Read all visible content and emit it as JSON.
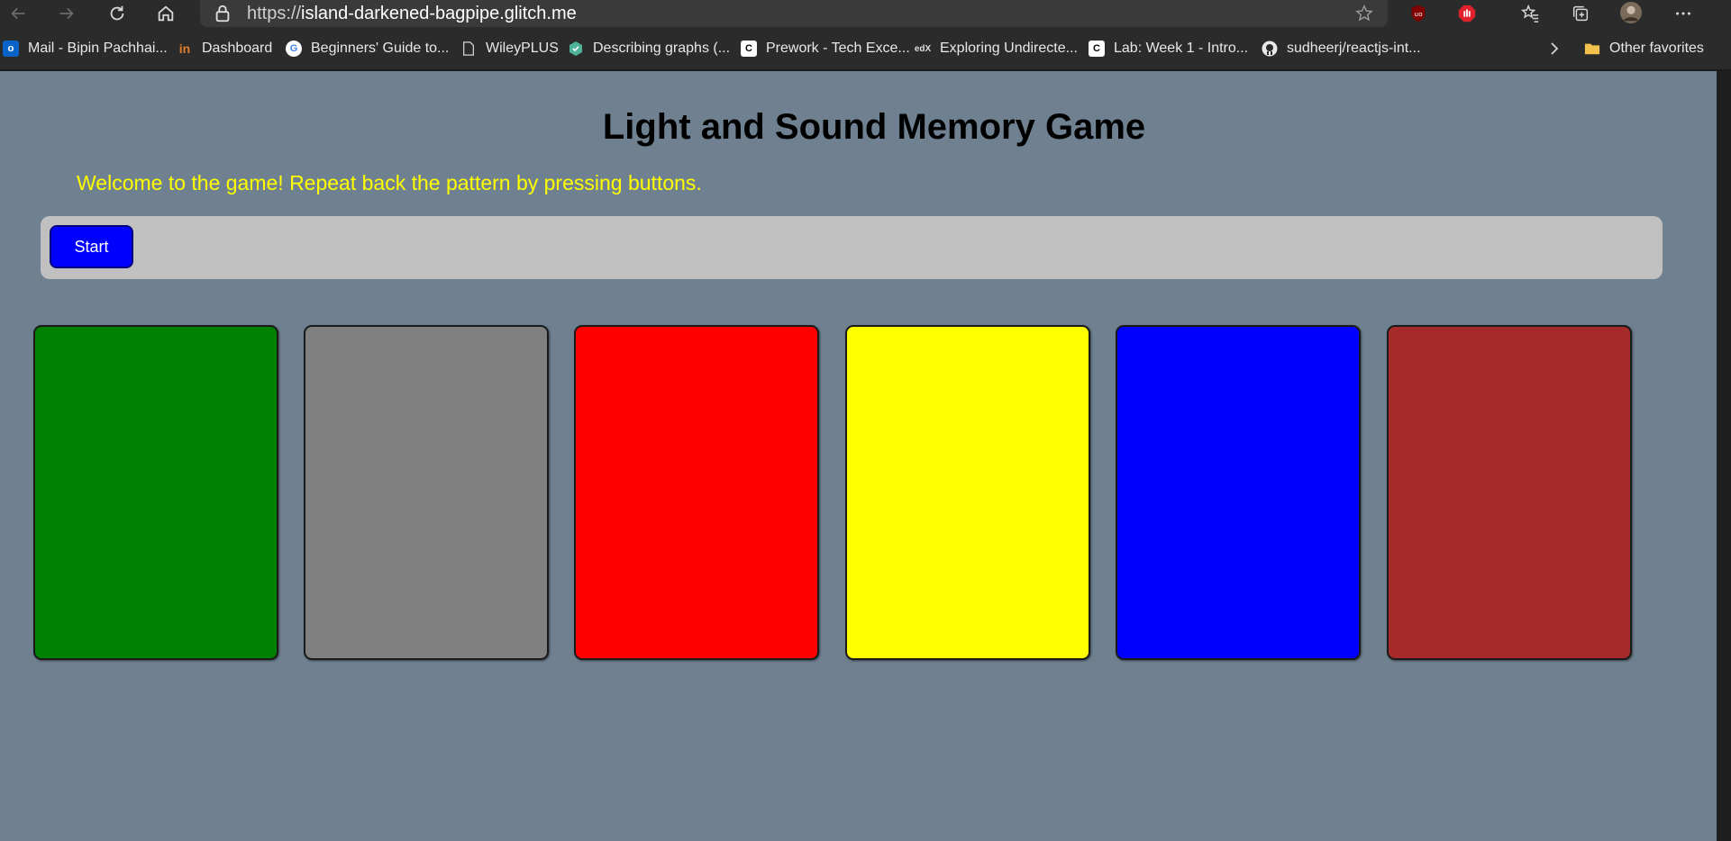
{
  "browser": {
    "url_prefix": "https://",
    "url_host": "island-darkened-bagpipe.glitch.me"
  },
  "bookmarks": [
    {
      "label": "Mail - Bipin Pachhai...",
      "icon": "outlook-icon"
    },
    {
      "label": "Dashboard",
      "icon": "dashboard-icon"
    },
    {
      "label": "Beginners' Guide to...",
      "icon": "google-icon"
    },
    {
      "label": "WileyPLUS",
      "icon": "page-icon"
    },
    {
      "label": "Describing graphs (...",
      "icon": "hexagon-icon"
    },
    {
      "label": "Prework - Tech Exce...",
      "icon": "c-icon"
    },
    {
      "label": "Exploring Undirecte...",
      "icon": "edx-icon"
    },
    {
      "label": "Lab: Week 1 - Intro...",
      "icon": "c-icon"
    },
    {
      "label": "sudheerj/reactjs-int...",
      "icon": "github-icon"
    }
  ],
  "other_favorites": "Other favorites",
  "page": {
    "title": "Light and Sound Memory Game",
    "welcome": "Welcome to the game! Repeat back the pattern by pressing buttons.",
    "start_label": "Start"
  },
  "game_buttons": [
    {
      "name": "game-button-green",
      "color": "#008000"
    },
    {
      "name": "game-button-gray",
      "color": "#808080"
    },
    {
      "name": "game-button-red",
      "color": "#ff0000"
    },
    {
      "name": "game-button-yellow",
      "color": "#ffff00"
    },
    {
      "name": "game-button-blue",
      "color": "#0000ff"
    },
    {
      "name": "game-button-brown",
      "color": "#a52a2a"
    }
  ]
}
